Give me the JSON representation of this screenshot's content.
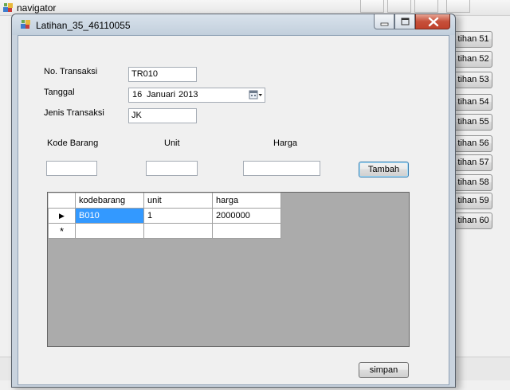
{
  "navigator": {
    "title": "navigator",
    "latihan_buttons": [
      "tihan 51",
      "tihan 52",
      "tihan 53",
      "tihan 54",
      "tihan 55",
      "tihan 56",
      "tihan 57",
      "tihan 58",
      "tihan 59",
      "tihan 60"
    ]
  },
  "dialog": {
    "title": "Latihan_35_46110055",
    "form": {
      "no_transaksi_label": "No. Transaksi",
      "no_transaksi_value": "TR010",
      "tanggal_label": "Tanggal",
      "tanggal_day": "16",
      "tanggal_month": "Januari",
      "tanggal_year": "2013",
      "jenis_label": "Jenis Transaksi",
      "jenis_value": "JK",
      "kode_barang_label": "Kode Barang",
      "unit_label": "Unit",
      "harga_label": "Harga",
      "kode_barang_value": "",
      "unit_value": "",
      "harga_value": "",
      "tambah_label": "Tambah",
      "simpan_label": "simpan"
    },
    "grid": {
      "columns": [
        "kodebarang",
        "unit",
        "harga"
      ],
      "rows": [
        {
          "indicator": "▶",
          "cells": [
            "B010",
            "1",
            "2000000"
          ]
        },
        {
          "indicator": "*",
          "cells": [
            "",
            "",
            ""
          ]
        }
      ]
    }
  },
  "colors": {
    "selection": "#3399ff",
    "grid_background": "#ababab",
    "close_button": "#c6503a"
  },
  "icons": [
    "app-icon",
    "minimize-icon",
    "maximize-icon",
    "close-icon",
    "calendar-icon",
    "row-pointer-icon",
    "new-row-icon"
  ]
}
